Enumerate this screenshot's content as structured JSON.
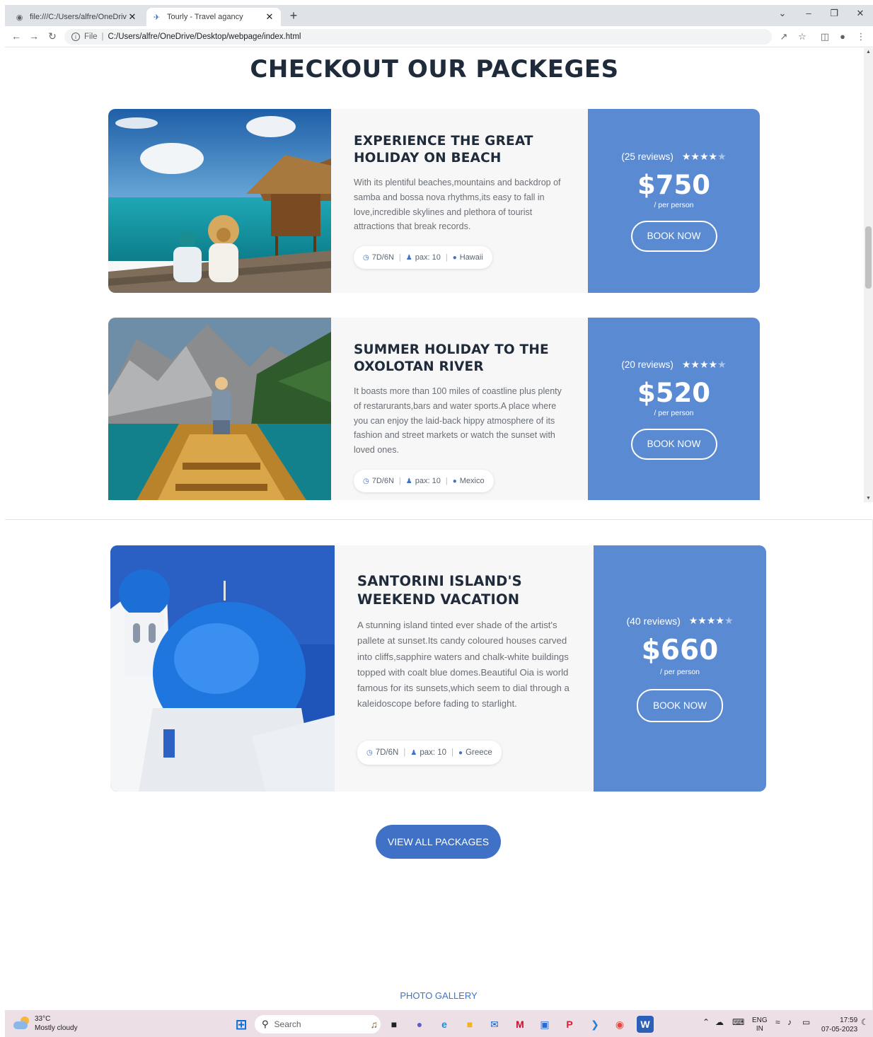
{
  "browser": {
    "tabs": [
      {
        "title": "file:///C:/Users/alfre/OneDrive/D",
        "active": false
      },
      {
        "title": "Tourly - Travel agancy",
        "active": true
      }
    ],
    "new_tab": "+",
    "url": {
      "protocol": "File",
      "path": "C:/Users/alfre/OneDrive/Desktop/webpage/index.html"
    }
  },
  "page": {
    "title": "CHECKOUT OUR PACKEGES",
    "view_all_label": "VIEW ALL PACKAGES",
    "footer_link": "PHOTO GALLERY"
  },
  "packages": [
    {
      "title": "EXPERIENCE THE GREAT HOLIDAY ON BEACH",
      "description": "With its plentiful beaches,mountains and backdrop of samba and bossa nova rhythms,its easy to fall in love,incredible skylines and plethora of tourist attractions that break records.",
      "duration": "7D/6N",
      "pax": "pax: 10",
      "location": "Hawaii",
      "reviews": "(25 reviews)",
      "rating": 4,
      "price": "$750",
      "per": "/ per person",
      "book_label": "BOOK NOW"
    },
    {
      "title": "SUMMER HOLIDAY TO THE OXOLOTAN RIVER",
      "description": "It boasts more than 100 miles of coastline plus plenty of restarurants,bars and water sports.A place where you can enjoy the laid-back hippy atmosphere of its fashion and street markets or watch the sunset with loved ones.",
      "duration": "7D/6N",
      "pax": "pax: 10",
      "location": "Mexico",
      "reviews": "(20 reviews)",
      "rating": 4,
      "price": "$520",
      "per": "/ per person",
      "book_label": "BOOK NOW"
    },
    {
      "title": "SANTORINI ISLAND'S WEEKEND VACATION",
      "description": "A stunning island tinted ever shade of the artist's pallete at sunset.Its candy coloured houses carved into cliffs,sapphire waters and chalk-white buildings topped with coalt blue domes.Beautiful Oia is world famous for its sunsets,which seem to dial through a kaleidoscope before fading to starlight.",
      "duration": "7D/6N",
      "pax": "pax: 10",
      "location": "Greece",
      "reviews": "(40 reviews)",
      "rating": 4,
      "price": "$660",
      "per": "/ per person",
      "book_label": "BOOK NOW"
    }
  ],
  "taskbar": {
    "weather_temp": "33°C",
    "weather_desc": "Mostly cloudy",
    "search_label": "Search",
    "lang_1": "ENG",
    "lang_2": "IN",
    "time": "17:59",
    "date": "07-05-2023"
  },
  "colors": {
    "accent": "#3f72c6",
    "price_panel": "#5a8ad2",
    "heading": "#1f2b3a",
    "body_text": "#6a6f76"
  }
}
